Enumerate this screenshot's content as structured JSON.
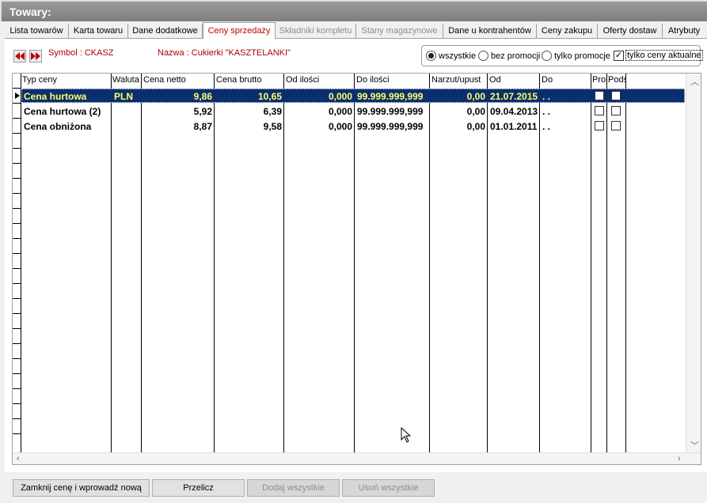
{
  "window": {
    "title": "Towary:"
  },
  "tabs": [
    {
      "label": "Lista towarów",
      "state": "normal"
    },
    {
      "label": "Karta towaru",
      "state": "normal"
    },
    {
      "label": "Dane dodatkowe",
      "state": "normal"
    },
    {
      "label": "Ceny sprzedaży",
      "state": "active"
    },
    {
      "label": "Składniki kompletu",
      "state": "disabled"
    },
    {
      "label": "Stany magazynowe",
      "state": "disabled"
    },
    {
      "label": "Dane u kontrahentów",
      "state": "normal"
    },
    {
      "label": "Ceny zakupu",
      "state": "normal"
    },
    {
      "label": "Oferty dostaw",
      "state": "normal"
    },
    {
      "label": "Atrybuty",
      "state": "normal"
    }
  ],
  "info": {
    "symbol": "Symbol : CKASZ",
    "nazwa": "Nazwa : Cukierki \"KASZTELANKI\""
  },
  "nav": {
    "prev_icon": "double-left-arrow-icon",
    "next_icon": "double-right-arrow-icon"
  },
  "filter": {
    "options": [
      {
        "label": "wszystkie",
        "selected": true
      },
      {
        "label": "bez promocji",
        "selected": false
      },
      {
        "label": "tylko promocje",
        "selected": false
      }
    ],
    "current_only": {
      "label": "tylko ceny aktualne",
      "checked": true
    }
  },
  "grid": {
    "headers": [
      "Typ ceny",
      "Waluta",
      "Cena netto",
      "Cena brutto",
      "Od ilości",
      "Do ilości",
      "Narzut/upust",
      "Od",
      "Do",
      "Pror",
      "Pods"
    ],
    "rows": [
      {
        "typ": "Cena hurtowa",
        "waluta": "PLN",
        "netto": "9,86",
        "brutto": "10,65",
        "od_ilosci": "0,000",
        "do_ilosci": "99.999.999,999",
        "narzut": "0,00",
        "od": "21.07.2015",
        "do": ". .",
        "selected": true
      },
      {
        "typ": "Cena hurtowa (2)",
        "waluta": "",
        "netto": "5,92",
        "brutto": "6,39",
        "od_ilosci": "0,000",
        "do_ilosci": "99.999.999,999",
        "narzut": "0,00",
        "od": "09.04.2013",
        "do": ". .",
        "selected": false
      },
      {
        "typ": "Cena obniżona",
        "waluta": "",
        "netto": "8,87",
        "brutto": "9,58",
        "od_ilosci": "0,000",
        "do_ilosci": "99.999.999,999",
        "narzut": "0,00",
        "od": "01.01.2011",
        "do": ". .",
        "selected": false
      }
    ]
  },
  "buttons": {
    "close_price": "Zamknij cenę i wprowadź nową",
    "recalc": "Przelicz",
    "add_all": "Dodaj wszystkie",
    "remove_all": "Usuń wszystkie"
  },
  "colors": {
    "selection": "#0a2e6e",
    "selection_text": "#ffff66",
    "active_tab": "#c00000",
    "info_label": "#b00000"
  }
}
